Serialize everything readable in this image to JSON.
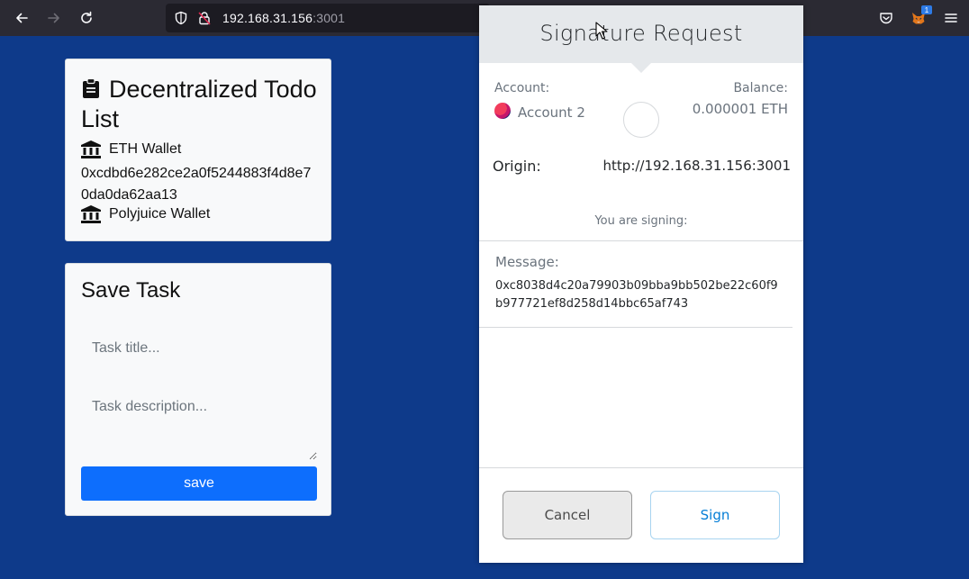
{
  "browser": {
    "url_host": "192.168.31.156",
    "url_port": ":3001",
    "extension_badge": "1"
  },
  "todo_card": {
    "title": "Decentralized Todo List",
    "eth_wallet_label": "ETH Wallet",
    "eth_address": "0xcdbd6e282ce2a0f5244883f4d8e70da0da62aa13",
    "polyjuice_wallet_label": "Polyjuice Wallet"
  },
  "save_card": {
    "title": "Save Task",
    "title_placeholder": "Task title...",
    "description_placeholder": "Task description...",
    "save_label": "save",
    "save_color": "#0d6efd"
  },
  "signature": {
    "title": "Signature Request",
    "account_label": "Account:",
    "account_name": "Account 2",
    "balance_label": "Balance:",
    "balance_value": "0.000001 ETH",
    "origin_label": "Origin:",
    "origin_value": "http://192.168.31.156:3001",
    "signing_text": "You are signing:",
    "message_label": "Message:",
    "message_value": "0xc8038d4c20a79903b09bba9bb502be22c60f9b977721ef8d258d14bbc65af743",
    "cancel_label": "Cancel",
    "sign_label": "Sign",
    "accent_color": "#037dd6"
  },
  "colors": {
    "page_background": "#0e3a8a",
    "toolbar": "#2b2a33"
  }
}
